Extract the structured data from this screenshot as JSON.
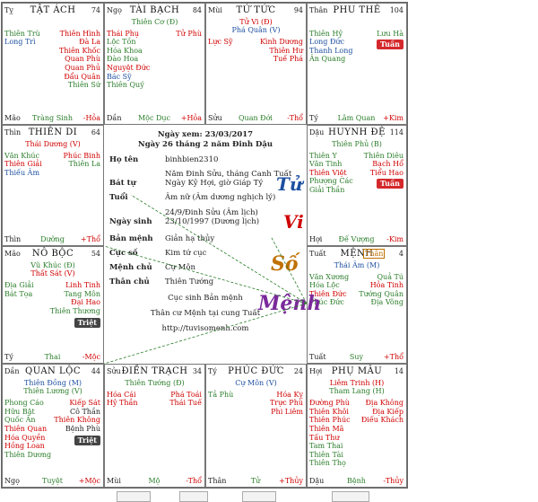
{
  "palaces": [
    {
      "id": "ty",
      "branch": "Tỵ",
      "name": "TẬT ÁCH",
      "num": "74",
      "main": [],
      "left": [
        {
          "t": "Thiên Trù",
          "c": "g"
        },
        {
          "t": "Long Trì",
          "c": "b"
        }
      ],
      "right": [
        {
          "t": "Thiên Hình",
          "c": "r"
        },
        {
          "t": "Đà La",
          "c": "r"
        },
        {
          "t": "Thiên Khốc",
          "c": "r"
        },
        {
          "t": "Quan Phù",
          "c": "r"
        },
        {
          "t": "Quan Phủ",
          "c": "r"
        },
        {
          "t": "Đẩu Quân",
          "c": "r"
        },
        {
          "t": "Thiên Sứ",
          "c": "g"
        }
      ],
      "foot": {
        "l": "Mão",
        "c": "Tràng Sinh",
        "r": "-Hỏa"
      }
    },
    {
      "id": "ngo",
      "branch": "Ngọ",
      "name": "TÀI BẠCH",
      "num": "84",
      "main": [
        {
          "t": "Thiên Cơ (Đ)",
          "c": "g"
        }
      ],
      "left": [
        {
          "t": "Thái Phụ",
          "c": "r"
        },
        {
          "t": "Lộc Tồn",
          "c": "g"
        },
        {
          "t": "Hóa Khoa",
          "c": "g"
        },
        {
          "t": "Đào Hoa",
          "c": "g"
        },
        {
          "t": "Nguyệt Đức",
          "c": "r"
        },
        {
          "t": "Bác Sỹ",
          "c": "b"
        },
        {
          "t": "Thiên Quý",
          "c": "g"
        }
      ],
      "right": [
        {
          "t": "Tử Phù",
          "c": "r"
        }
      ],
      "foot": {
        "l": "Dần",
        "c": "Mộc Dục",
        "r": "+Hỏa"
      }
    },
    {
      "id": "mui",
      "branch": "Mùi",
      "name": "TỬ TỨC",
      "num": "94",
      "main": [
        {
          "t": "Tử Vi (Đ)",
          "c": "r"
        },
        {
          "t": "Phá Quân (V)",
          "c": "b"
        }
      ],
      "left": [
        {
          "t": "Lực Sỹ",
          "c": "r"
        }
      ],
      "right": [
        {
          "t": "Kình Dương",
          "c": "r"
        },
        {
          "t": "Thiên Hư",
          "c": "r"
        },
        {
          "t": "Tuế Phá",
          "c": "r"
        }
      ],
      "foot": {
        "l": "Sửu",
        "c": "Quan Đới",
        "r": "-Thổ"
      }
    },
    {
      "id": "than_tr",
      "branch": "Thân",
      "name": "PHU THÊ",
      "num": "104",
      "main": [],
      "left": [
        {
          "t": "Thiên Hỷ",
          "c": "g"
        },
        {
          "t": "Long Đức",
          "c": "b"
        },
        {
          "t": "Thanh Long",
          "c": "b"
        },
        {
          "t": "Ân Quang",
          "c": "g"
        }
      ],
      "right": [
        {
          "t": "Lưu Hà",
          "c": "g"
        }
      ],
      "badge": {
        "t": "Tuần",
        "c": "red"
      },
      "foot": {
        "l": "Tý",
        "c": "Lâm Quan",
        "r": "+Kim"
      }
    },
    {
      "id": "thin",
      "branch": "Thìn",
      "name": "THIÊN DI",
      "num": "64",
      "main": [
        {
          "t": "Thái Dương (V)",
          "c": "r"
        }
      ],
      "left": [
        {
          "t": "Văn Khúc",
          "c": "g"
        },
        {
          "t": "Thiên Giải",
          "c": "r"
        },
        {
          "t": "Thiếu Âm",
          "c": "b"
        }
      ],
      "right": [
        {
          "t": "Phúc Binh",
          "c": "r"
        },
        {
          "t": "Thiên La",
          "c": "g"
        }
      ],
      "foot": {
        "l": "Thìn",
        "c": "Dưỡng",
        "r": "+Thổ"
      }
    },
    {
      "id": "dau",
      "branch": "Dậu",
      "name": "HUYNH ĐỆ",
      "num": "114",
      "main": [
        {
          "t": "Thiên Phủ (B)",
          "c": "g"
        }
      ],
      "left": [
        {
          "t": "Thiên Y",
          "c": "g"
        },
        {
          "t": "Văn Tinh",
          "c": "g"
        },
        {
          "t": "Thiên Việt",
          "c": "r"
        },
        {
          "t": "Phượng Các",
          "c": "g"
        },
        {
          "t": "Giải Thần",
          "c": "g"
        }
      ],
      "right": [
        {
          "t": "Thiên Diêu",
          "c": "g"
        },
        {
          "t": "Bạch Hổ",
          "c": "r"
        },
        {
          "t": "Tiểu Hao",
          "c": "r"
        }
      ],
      "badge": {
        "t": "Tuần",
        "c": "red"
      },
      "foot": {
        "l": "Hợi",
        "c": "Đế Vượng",
        "r": "-Kim"
      }
    },
    {
      "id": "mao",
      "branch": "Mão",
      "name": "NÔ BỘC",
      "num": "54",
      "main": [
        {
          "t": "Vũ Khúc (Đ)",
          "c": "g"
        },
        {
          "t": "Thất Sát (V)",
          "c": "r"
        }
      ],
      "left": [
        {
          "t": "Địa Giải",
          "c": "g"
        },
        {
          "t": "Bát Tọa",
          "c": "g"
        }
      ],
      "right": [
        {
          "t": "Linh Tinh",
          "c": "r"
        },
        {
          "t": "Tang Môn",
          "c": "g"
        },
        {
          "t": "Đại Hao",
          "c": "r"
        },
        {
          "t": "Thiên Thương",
          "c": "g"
        }
      ],
      "badge": {
        "t": "Triệt",
        "c": "gray"
      },
      "foot": {
        "l": "Tý",
        "c": "Thai",
        "r": "-Mộc"
      }
    },
    {
      "id": "tuat",
      "branch": "Tuất",
      "name": "MỆNH",
      "num": "4",
      "than_tag": "Thân",
      "main": [
        {
          "t": "Thái Âm (M)",
          "c": "b"
        }
      ],
      "left": [
        {
          "t": "Văn Xương",
          "c": "g"
        },
        {
          "t": "Hóa Lộc",
          "c": "g"
        },
        {
          "t": "Thiên Đức",
          "c": "r"
        },
        {
          "t": "Phúc Đức",
          "c": "g"
        }
      ],
      "right": [
        {
          "t": "Quả Tú",
          "c": "g"
        },
        {
          "t": "Hỏa Tinh",
          "c": "r"
        },
        {
          "t": "Tướng Quân",
          "c": "g"
        },
        {
          "t": "Địa Võng",
          "c": "g"
        }
      ],
      "foot": {
        "l": "Tuất",
        "c": "Suy",
        "r": "+Thổ"
      }
    },
    {
      "id": "dan",
      "branch": "Dần",
      "name": "QUAN LỘC",
      "num": "44",
      "main": [
        {
          "t": "Thiên Đồng (M)",
          "c": "b"
        },
        {
          "t": "Thiên Lương (V)",
          "c": "g"
        }
      ],
      "left": [
        {
          "t": "Phong Cáo",
          "c": "g"
        },
        {
          "t": "Hữu Bật",
          "c": "g"
        },
        {
          "t": "Quốc Ấn",
          "c": "g"
        },
        {
          "t": "Thiên Quan",
          "c": "r"
        },
        {
          "t": "Hóa Quyền",
          "c": "r"
        },
        {
          "t": "Hồng Loan",
          "c": "r"
        },
        {
          "t": "Thiên Dương",
          "c": "g"
        }
      ],
      "right": [
        {
          "t": "Kiếp Sát",
          "c": "r"
        },
        {
          "t": "Cô Thần",
          "c": "k"
        },
        {
          "t": "Thiên Không",
          "c": "r"
        },
        {
          "t": "Bệnh Phù",
          "c": "k"
        }
      ],
      "badge": {
        "t": "Triệt",
        "c": "gray"
      },
      "foot": {
        "l": "Ngọ",
        "c": "Tuyệt",
        "r": "+Mộc"
      }
    },
    {
      "id": "suu",
      "branch": "Sửu",
      "name": "ĐIỀN TRẠCH",
      "num": "34",
      "main": [
        {
          "t": "Thiên Tướng (Đ)",
          "c": "g"
        }
      ],
      "left": [
        {
          "t": "Hóa Cái",
          "c": "r"
        },
        {
          "t": "Hỷ Thần",
          "c": "r"
        }
      ],
      "right": [
        {
          "t": "Phá Toái",
          "c": "r"
        },
        {
          "t": "Thái Tuế",
          "c": "r"
        }
      ],
      "foot": {
        "l": "Mùi",
        "c": "Mộ",
        "r": "-Thổ"
      }
    },
    {
      "id": "ty2",
      "branch": "Tý",
      "name": "PHÚC ĐỨC",
      "num": "24",
      "main": [
        {
          "t": "Cự Môn (V)",
          "c": "b"
        }
      ],
      "left": [
        {
          "t": "Tả Phù",
          "c": "g"
        }
      ],
      "right": [
        {
          "t": "Hóa Kỵ",
          "c": "r"
        },
        {
          "t": "Trực Phù",
          "c": "r"
        },
        {
          "t": "Phi Liêm",
          "c": "r"
        }
      ],
      "foot": {
        "l": "Thân",
        "c": "Tử",
        "r": "+Thủy"
      }
    },
    {
      "id": "hoi",
      "branch": "Hợi",
      "name": "PHỤ MẪU",
      "num": "14",
      "main": [
        {
          "t": "Liêm Trinh (H)",
          "c": "r"
        },
        {
          "t": "Tham Lang (H)",
          "c": "g"
        }
      ],
      "left": [
        {
          "t": "Đường Phù",
          "c": "r"
        },
        {
          "t": "Thiên Khôi",
          "c": "r"
        },
        {
          "t": "Thiên Phúc",
          "c": "r"
        },
        {
          "t": "Thiên Mã",
          "c": "r"
        },
        {
          "t": "Tấu Thư",
          "c": "r"
        },
        {
          "t": "Tam Thai",
          "c": "g"
        },
        {
          "t": "Thiên Tài",
          "c": "g"
        },
        {
          "t": "Thiên Thọ",
          "c": "g"
        }
      ],
      "right": [
        {
          "t": "Địa Không",
          "c": "r"
        },
        {
          "t": "Địa Kiếp",
          "c": "r"
        },
        {
          "t": "Điếu Khách",
          "c": "r"
        }
      ],
      "foot": {
        "l": "Dậu",
        "c": "Bệnh",
        "r": "-Thủy"
      }
    }
  ],
  "center": {
    "line1": "Ngày xem: 23/03/2017",
    "line2": "Ngày 26 tháng 2 năm Đinh Dậu",
    "rows": [
      {
        "lbl": "Họ tên",
        "val": "binhbien2310"
      },
      {
        "lbl": "Bát tự",
        "val": "Năm Đinh Sửu, tháng Canh Tuất\nNgày Kỷ Hợi, giờ Giáp Tý"
      },
      {
        "lbl": "Tuổi",
        "val": "Âm nữ (Âm dương nghịch lý)"
      },
      {
        "lbl": "Ngày sinh",
        "val": "24/9/Đinh Sửu (Âm lịch)\n23/10/1997 (Dương lịch)"
      },
      {
        "lbl": "Bản mệnh",
        "val": "Giản hạ thủy"
      },
      {
        "lbl": "Cục số",
        "val": "Kim tứ cục"
      },
      {
        "lbl": "Mệnh chủ",
        "val": "Cự Môn"
      },
      {
        "lbl": "Thân chủ",
        "val": "Thiên Tướng"
      }
    ],
    "note1": "Cục sinh Bản mệnh",
    "note2": "Thân cư Mệnh tại cung Tuất",
    "url": "http://tuvisomenh.com",
    "watermark": [
      "Tử",
      "Vi",
      "Số",
      "Mệnh"
    ]
  },
  "colors": {
    "green": "#2a7d2a",
    "red": "#d00000",
    "blue": "#1e50a0",
    "badge_red": "#d4292c"
  }
}
